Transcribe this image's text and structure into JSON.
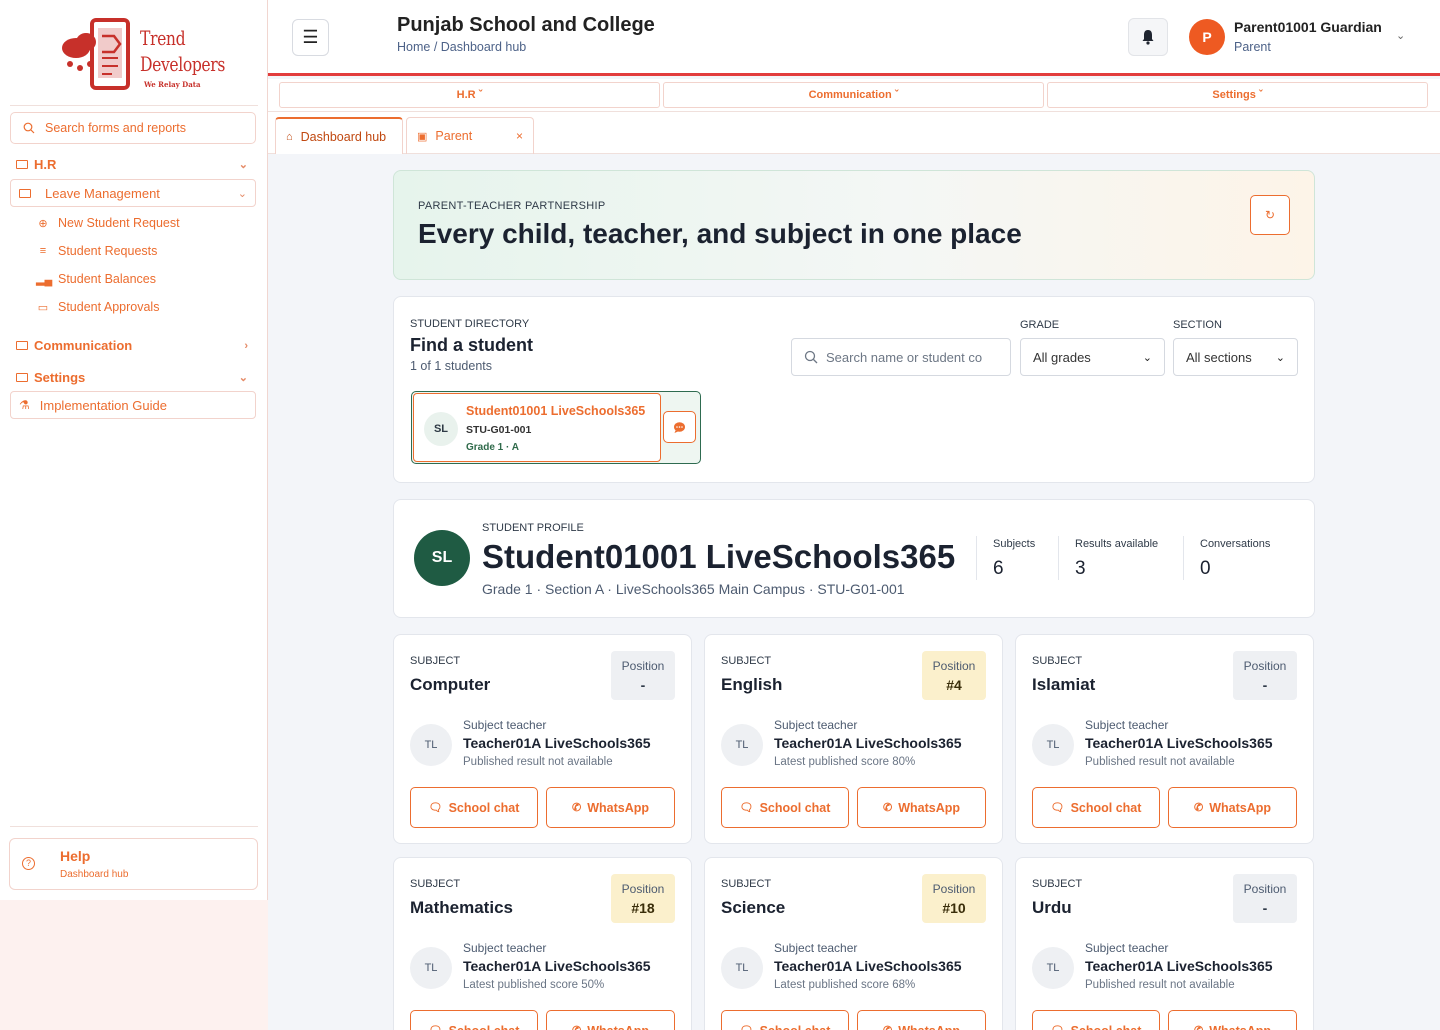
{
  "brand": {
    "line1": "Trend",
    "line2": "Developers",
    "tagline": "We Relay Data"
  },
  "sidebar": {
    "search_placeholder": "Search forms and reports",
    "sections": [
      {
        "label": "H.R"
      },
      {
        "label": "Leave Management"
      },
      {
        "label": "Communication"
      },
      {
        "label": "Settings"
      },
      {
        "label": "Implementation Guide"
      }
    ],
    "leave_items": [
      {
        "label": "New Student Request",
        "icon": "plus-circle-icon"
      },
      {
        "label": "Student Requests",
        "icon": "list-icon"
      },
      {
        "label": "Student Balances",
        "icon": "bar-chart-icon"
      },
      {
        "label": "Student Approvals",
        "icon": "inbox-icon"
      }
    ],
    "help": {
      "title": "Help",
      "subtitle": "Dashboard hub"
    }
  },
  "header": {
    "school": "Punjab School and College",
    "breadcrumb": "Home / Dashboard hub",
    "user": {
      "initial": "P",
      "name": "Parent01001 Guardian",
      "role": "Parent"
    }
  },
  "menubar": [
    {
      "label": "H.R"
    },
    {
      "label": "Communication"
    },
    {
      "label": "Settings"
    }
  ],
  "tabs": [
    {
      "label": "Dashboard hub"
    },
    {
      "label": "Parent"
    }
  ],
  "hero": {
    "eyebrow": "PARENT-TEACHER PARTNERSHIP",
    "title": "Every child, teacher, and subject in one place"
  },
  "directory": {
    "eyebrow": "STUDENT DIRECTORY",
    "title": "Find a student",
    "count": "1 of 1 students",
    "search_placeholder": "Search name or student co",
    "grade_label": "GRADE",
    "grade_value": "All grades",
    "section_label": "SECTION",
    "section_value": "All sections",
    "student": {
      "initials": "SL",
      "name": "Student01001 LiveSchools365",
      "code": "STU-G01-001",
      "grade": "Grade 1 · A"
    }
  },
  "profile": {
    "eyebrow": "STUDENT PROFILE",
    "initials": "SL",
    "name": "Student01001 LiveSchools365",
    "meta": "Grade 1 · Section A · LiveSchools365 Main Campus · STU-G01-001",
    "stats": [
      {
        "label": "Subjects",
        "value": "6"
      },
      {
        "label": "Results available",
        "value": "3"
      },
      {
        "label": "Conversations",
        "value": "0"
      }
    ]
  },
  "subject_labels": {
    "eyebrow": "SUBJECT",
    "position": "Position",
    "teacher_label": "Subject teacher",
    "school_chat": "School chat",
    "whatsapp": "WhatsApp"
  },
  "subjects": [
    {
      "name": "Computer",
      "position": "-",
      "teacher_initials": "TL",
      "teacher": "Teacher01A LiveSchools365",
      "status": "Published result not available"
    },
    {
      "name": "English",
      "position": "#4",
      "teacher_initials": "TL",
      "teacher": "Teacher01A LiveSchools365",
      "status": "Latest published score 80%"
    },
    {
      "name": "Islamiat",
      "position": "-",
      "teacher_initials": "TL",
      "teacher": "Teacher01A LiveSchools365",
      "status": "Published result not available"
    },
    {
      "name": "Mathematics",
      "position": "#18",
      "teacher_initials": "TL",
      "teacher": "Teacher01A LiveSchools365",
      "status": "Latest published score 50%"
    },
    {
      "name": "Science",
      "position": "#10",
      "teacher_initials": "TL",
      "teacher": "Teacher01A LiveSchools365",
      "status": "Latest published score 68%"
    },
    {
      "name": "Urdu",
      "position": "-",
      "teacher_initials": "TL",
      "teacher": "Teacher01A LiveSchools365",
      "status": "Published result not available"
    }
  ],
  "colors": {
    "accent": "#ec6d2f",
    "brand_red": "#e23c3c",
    "profile_green": "#1f5b43"
  }
}
